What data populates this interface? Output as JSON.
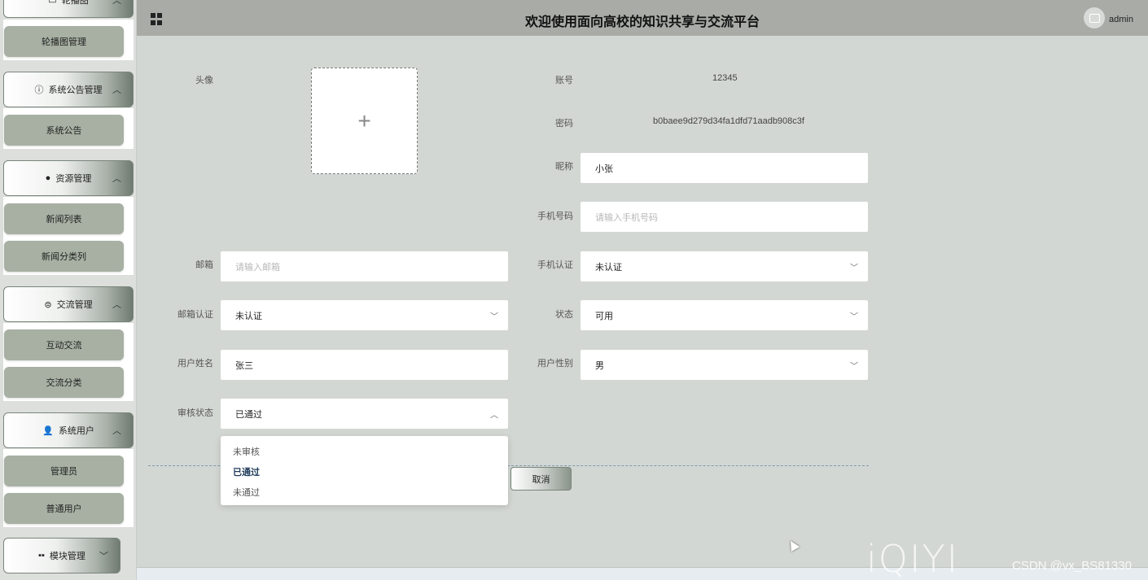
{
  "sidebar": {
    "groups": [
      {
        "label": "轮播图",
        "icon": "image-icon"
      },
      {
        "label": "系统公告管理",
        "icon": "info-circle-icon"
      },
      {
        "label": "资源管理",
        "icon": "bulb-icon"
      },
      {
        "label": "交流管理",
        "icon": "chat-icon"
      },
      {
        "label": "系统用户",
        "icon": "user-icon"
      },
      {
        "label": "模块管理",
        "icon": "grid-icon"
      }
    ],
    "items": {
      "carousel_manage": "轮播图管理",
      "system_notice": "系统公告",
      "news_list": "新闻列表",
      "news_category": "新闻分类列",
      "interaction": "互动交流",
      "interaction_category": "交流分类",
      "admin": "管理员",
      "normal_user": "普通用户"
    }
  },
  "header": {
    "title": "欢迎使用面向高校的知识共享与交流平台",
    "username": "admin"
  },
  "form": {
    "avatar_label": "头像",
    "account_label": "账号",
    "account_value": "12345",
    "password_label": "密码",
    "password_value": "b0baee9d279d34fa1dfd71aadb908c3f",
    "nickname_label": "昵称",
    "nickname_value": "小张",
    "phone_label": "手机号码",
    "phone_placeholder": "请输入手机号码",
    "email_label": "邮箱",
    "email_placeholder": "请输入邮箱",
    "phone_verify_label": "手机认证",
    "phone_verify_value": "未认证",
    "email_verify_label": "邮箱认证",
    "email_verify_value": "未认证",
    "status_label": "状态",
    "status_value": "可用",
    "real_name_label": "用户姓名",
    "real_name_value": "张三",
    "gender_label": "用户性别",
    "gender_value": "男",
    "audit_label": "审核状态",
    "audit_value": "已通过",
    "audit_options": [
      "未审核",
      "已通过",
      "未通过"
    ],
    "cancel_label": "取消"
  },
  "watermark": {
    "logo": "iQIYI",
    "csdn": "CSDN @vx_BS81330"
  }
}
